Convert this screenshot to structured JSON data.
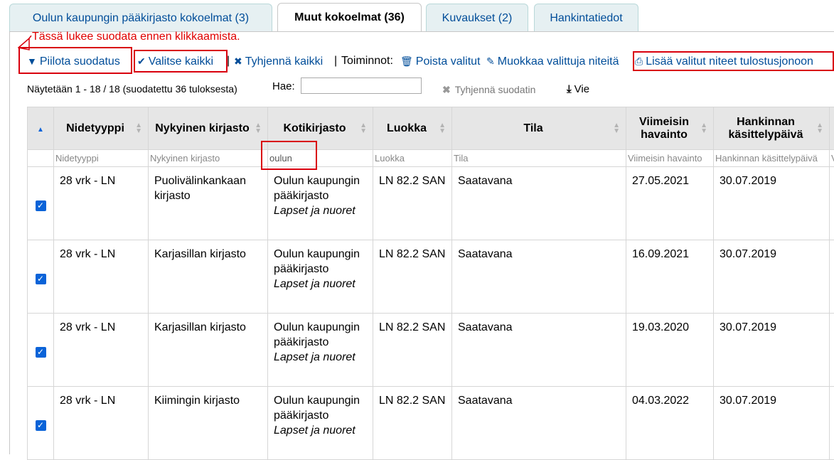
{
  "tabs": [
    {
      "label": "Oulun kaupungin pääkirjasto kokoelmat (3)",
      "active": false
    },
    {
      "label": "Muut kokoelmat (36)",
      "active": true
    },
    {
      "label": "Kuvaukset (2)",
      "active": false
    },
    {
      "label": "Hankintatiedot",
      "active": false
    }
  ],
  "annotation": "Tässä lukee suodata ennen klikkaamista.",
  "toolbar": {
    "hide_filter": "Piilota suodatus",
    "select_all": "Valitse kaikki",
    "clear_all": "Tyhjennä kaikki",
    "actions_label": "Toiminnot:",
    "delete_selected": "Poista valitut",
    "edit_selected": "Muokkaa valittuja niteitä",
    "add_to_print_queue": "Lisää valitut niteet tulostusjonoon",
    "separator": "|"
  },
  "info_text": "Näytetään 1 - 18 / 18 (suodatettu 36 tuloksesta)",
  "search": {
    "label": "Hae:",
    "value": ""
  },
  "clear_filter": "Tyhjennä suodatin",
  "export": "Vie",
  "columns": [
    "Nidetyyppi",
    "Nykyinen kirjasto",
    "Kotikirjasto",
    "Luokka",
    "Tila",
    "Viimeisin havainto",
    "Hankinnan käsittelypäivä"
  ],
  "filters": [
    "Nidetyyppi",
    "Nykyinen kirjasto",
    "oulun",
    "Luokka",
    "Tila",
    "Viimeisin havainto",
    "Hankinnan käsittelypäivä"
  ],
  "rows": [
    {
      "type": "28 vrk - LN",
      "current": "Puolivälinkankaan kirjasto",
      "home": "Oulun kaupungin pääkirjasto",
      "location": "Lapset ja nuoret",
      "class": "LN 82.2 SAN",
      "status": "Saatavana",
      "seen": "27.05.2021",
      "acq": "30.07.2019"
    },
    {
      "type": "28 vrk - LN",
      "current": "Karjasillan kirjasto",
      "home": "Oulun kaupungin pääkirjasto",
      "location": "Lapset ja nuoret",
      "class": "LN 82.2 SAN",
      "status": "Saatavana",
      "seen": "16.09.2021",
      "acq": "30.07.2019"
    },
    {
      "type": "28 vrk - LN",
      "current": "Karjasillan kirjasto",
      "home": "Oulun kaupungin pääkirjasto",
      "location": "Lapset ja nuoret",
      "class": "LN 82.2 SAN",
      "status": "Saatavana",
      "seen": "19.03.2020",
      "acq": "30.07.2019"
    },
    {
      "type": "28 vrk - LN",
      "current": "Kiimingin kirjasto",
      "home": "Oulun kaupungin pääkirjasto",
      "location": "Lapset ja nuoret",
      "class": "LN 82.2 SAN",
      "status": "Saatavana",
      "seen": "04.03.2022",
      "acq": "30.07.2019"
    }
  ],
  "colors": {
    "link": "#004d99",
    "highlight": "#d9000d",
    "checkbox": "#0a63d8"
  }
}
